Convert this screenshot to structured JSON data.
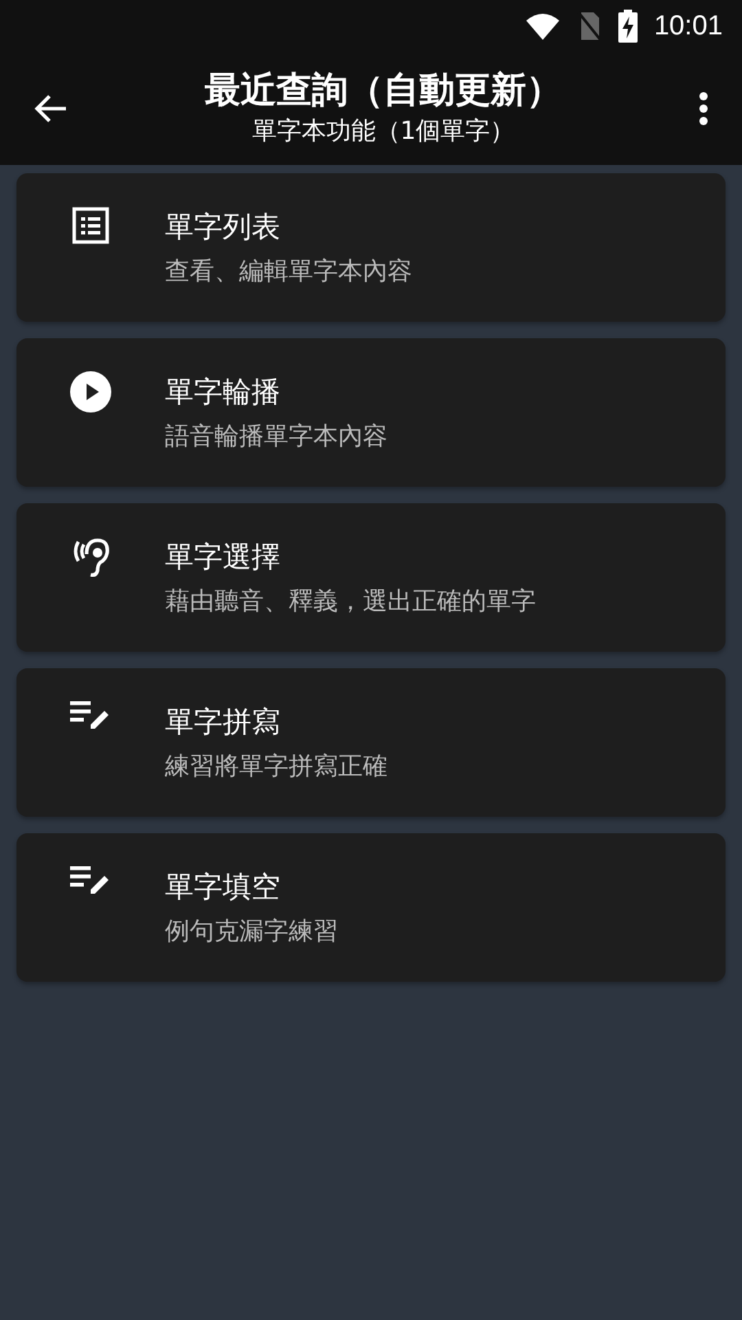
{
  "status_bar": {
    "time": "10:01"
  },
  "toolbar": {
    "title": "最近查詢（自動更新）",
    "subtitle": "單字本功能（1個單字）"
  },
  "items": [
    {
      "kind": "list",
      "title": "單字列表",
      "subtitle": "查看、編輯單字本內容"
    },
    {
      "kind": "playback",
      "title": "單字輪播",
      "subtitle": "語音輪播單字本內容"
    },
    {
      "kind": "listening",
      "title": "單字選擇",
      "subtitle": "藉由聽音、釋義，選出正確的單字"
    },
    {
      "kind": "writing",
      "title": "單字拼寫",
      "subtitle": "練習將單字拼寫正確"
    },
    {
      "kind": "writing",
      "title": "單字填空",
      "subtitle": "例句克漏字練習"
    }
  ]
}
